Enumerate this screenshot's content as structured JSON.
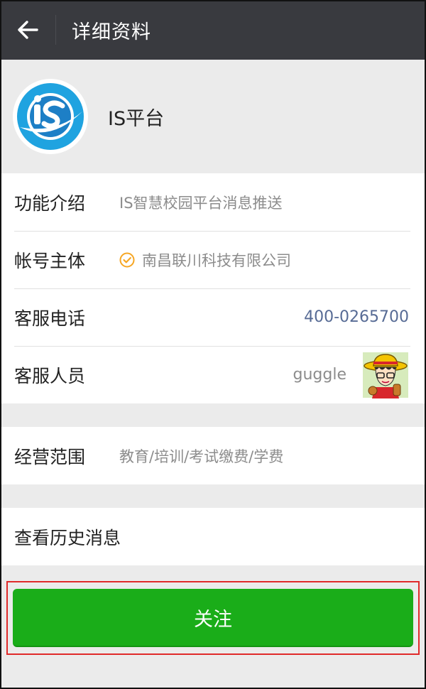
{
  "topbar": {
    "title": "详细资料",
    "back_icon": "arrow-left-icon"
  },
  "profile": {
    "name": "IS平台",
    "avatar_logo_text": "iS"
  },
  "info": {
    "intro_label": "功能介绍",
    "intro_value": "IS智慧校园平台消息推送",
    "owner_label": "帐号主体",
    "owner_value": "南昌联川科技有限公司",
    "verified_icon": "verified-check-icon",
    "phone_label": "客服电话",
    "phone_value": "400-0265700",
    "agent_label": "客服人员",
    "agent_name": "guggle"
  },
  "business": {
    "label": "经营范围",
    "value": "教育/培训/考试缴费/学费"
  },
  "history": {
    "label": "查看历史消息"
  },
  "actions": {
    "follow_label": "关注"
  },
  "colors": {
    "topbar_bg": "#393a3f",
    "page_bg": "#ebebeb",
    "follow_green": "#1aad19",
    "link_blue": "#576b95",
    "highlight_red": "#e02a2a",
    "verified_orange": "#f6a623"
  }
}
